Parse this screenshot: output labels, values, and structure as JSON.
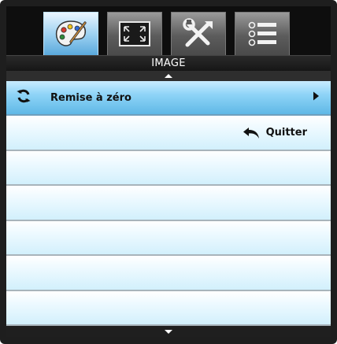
{
  "tabs": [
    {
      "id": "image",
      "icon": "palette-icon",
      "active": true
    },
    {
      "id": "display",
      "icon": "screen-fit-icon",
      "active": false
    },
    {
      "id": "setup",
      "icon": "tools-icon",
      "active": false
    },
    {
      "id": "options",
      "icon": "list-icon",
      "active": false
    }
  ],
  "menu": {
    "title": "IMAGE",
    "items": [
      {
        "label": "Remise à zéro",
        "icon": "reset-icon",
        "has_submenu": true
      },
      {
        "label": "Quitter",
        "icon": "return-icon"
      }
    ]
  },
  "colors": {
    "selected_row": "#8fd4f7",
    "row": "#ecf9ff",
    "active_tab": "#9fd2f2",
    "frame": "#1e1e1e"
  }
}
